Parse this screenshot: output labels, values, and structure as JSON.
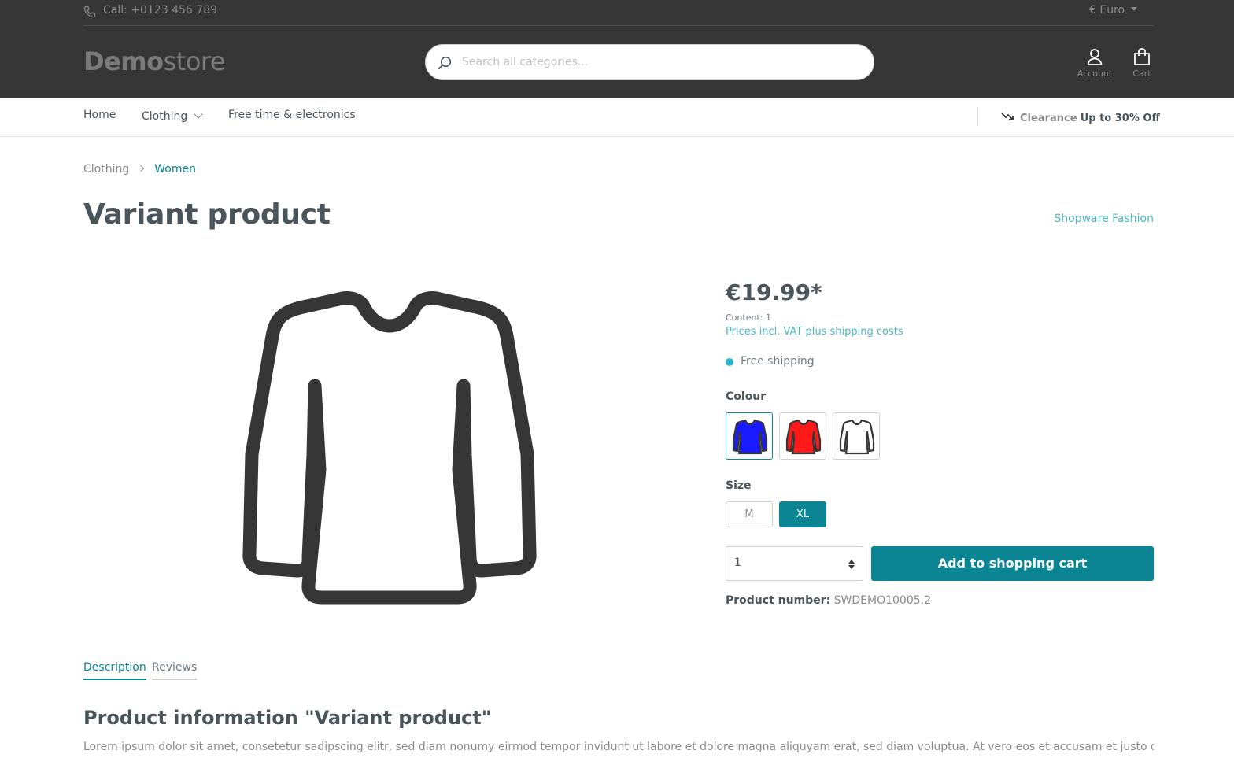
{
  "header": {
    "phone_text": "Call: +0123 456 789",
    "currency_label": "€ Euro",
    "logo_bold": "Demo",
    "logo_light": "store",
    "search_placeholder": "Search all categories...",
    "account_label": "Account",
    "cart_label": "Cart"
  },
  "nav": {
    "items": [
      {
        "label": "Home"
      },
      {
        "label": "Clothing"
      },
      {
        "label": "Free time & electronics"
      }
    ],
    "promo_label": "Clearance",
    "promo_text": "Up to 30% Off"
  },
  "breadcrumb": [
    "Clothing",
    "Women"
  ],
  "product": {
    "title": "Variant product",
    "manufacturer": "Shopware Fashion",
    "price": "€19.99*",
    "content": "Content: 1",
    "vat_note": "Prices incl. VAT plus shipping costs",
    "shipping": "Free shipping",
    "colour_label": "Colour",
    "colours": [
      {
        "name": "blue",
        "fill": "#1a1aff",
        "selected": true
      },
      {
        "name": "red",
        "fill": "#ff1a1a",
        "selected": false
      },
      {
        "name": "white",
        "fill": "#ffffff",
        "selected": false
      }
    ],
    "size_label": "Size",
    "sizes": [
      {
        "label": "M",
        "selected": false
      },
      {
        "label": "XL",
        "selected": true
      }
    ],
    "quantity": "1",
    "add_to_cart": "Add to shopping cart",
    "product_number_label": "Product number:",
    "product_number": "SWDEMO10005.2"
  },
  "tabs": [
    {
      "label": "Description",
      "active": true
    },
    {
      "label": "Reviews",
      "active": false
    }
  ],
  "description": {
    "title": "Product information \"Variant product\"",
    "text": "Lorem ipsum dolor sit amet, consetetur sadipscing elitr, sed diam nonumy eirmod tempor invidunt ut labore et dolore magna aliquyam erat, sed diam voluptua. At vero eos et accusam et justo duo"
  },
  "colors": {
    "accent": "#0b8494",
    "header_bg": "#363636",
    "link": "#4cb8c5",
    "shipping_dot": "#26b6cf"
  }
}
